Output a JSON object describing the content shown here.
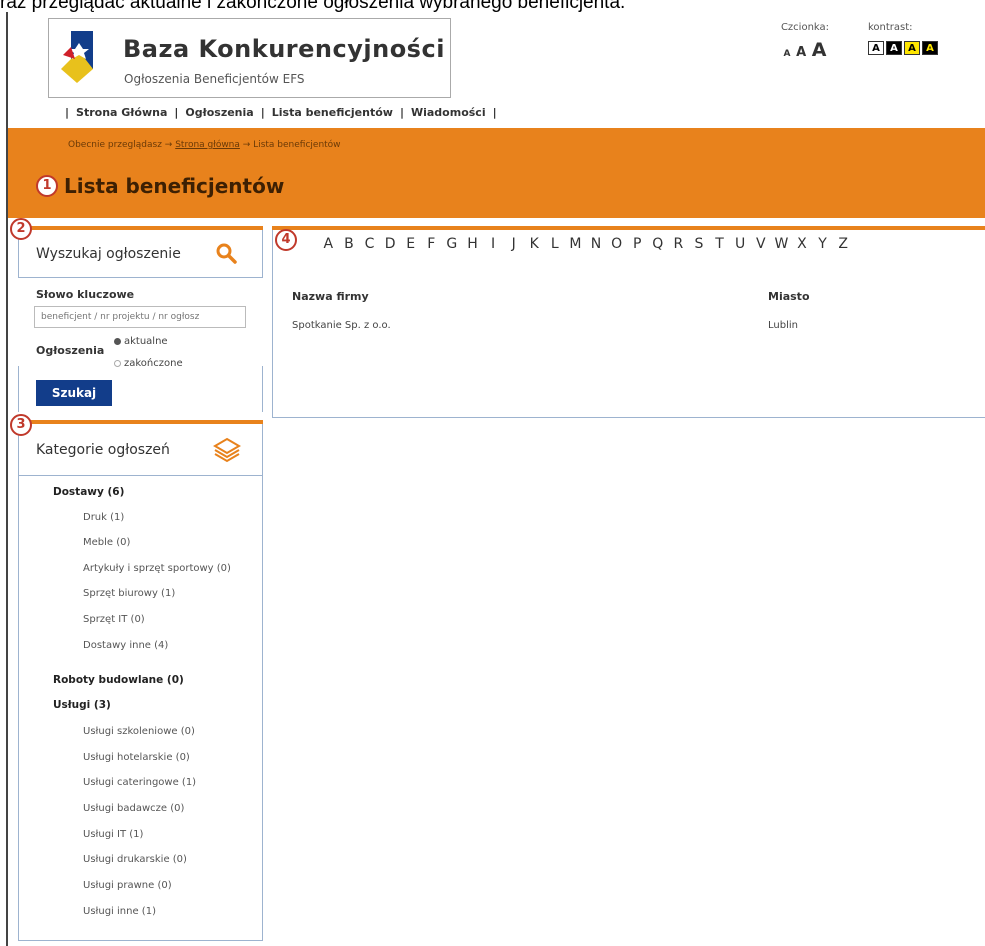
{
  "caption": "raz przeglądać aktualne i zakończone ogłoszenia wybranego beneficjenta.",
  "header": {
    "site_title": "Baza Konkurencyjności",
    "site_subtitle": "Ogłoszenia Beneficjentów EFS",
    "font_label": "Czcionka:",
    "font_sizes": [
      "A",
      "A",
      "A"
    ],
    "contrast_label": "kontrast:",
    "contrast_options": [
      "A",
      "A",
      "A",
      "A"
    ]
  },
  "nav": {
    "items": [
      "Strona Główna",
      "Ogłoszenia",
      "Lista beneficjentów",
      "Wiadomości"
    ]
  },
  "breadcrumb": {
    "prefix": "Obecnie przeglądasz →",
    "home": "Strona główna",
    "current": "→ Lista beneficjentów"
  },
  "page_title": "Lista beneficjentów",
  "badges": [
    "1",
    "2",
    "3",
    "4"
  ],
  "search": {
    "title": "Wyszukaj ogłoszenie",
    "keyword_label": "Słowo kluczowe",
    "keyword_placeholder": "beneficjent / nr projektu / nr ogłosz",
    "status_label": "Ogłoszenia",
    "options": [
      "aktualne",
      "zakończone"
    ],
    "selected": "aktualne",
    "button": "Szukaj"
  },
  "categories": {
    "title": "Kategorie ogłoszeń",
    "items": [
      {
        "label": "Dostawy (6)",
        "level": 0
      },
      {
        "label": "Druk (1)",
        "level": 1
      },
      {
        "label": "Meble (0)",
        "level": 1
      },
      {
        "label": "Artykuły i sprzęt sportowy (0)",
        "level": 1
      },
      {
        "label": "Sprzęt biurowy (1)",
        "level": 1
      },
      {
        "label": "Sprzęt IT (0)",
        "level": 1
      },
      {
        "label": "Dostawy inne (4)",
        "level": 1
      },
      {
        "label": "Roboty budowlane (0)",
        "level": 0
      },
      {
        "label": "Usługi (3)",
        "level": 0
      },
      {
        "label": "Usługi szkoleniowe (0)",
        "level": 1
      },
      {
        "label": "Usługi hotelarskie (0)",
        "level": 1
      },
      {
        "label": "Usługi cateringowe (1)",
        "level": 1
      },
      {
        "label": "Usługi badawcze (0)",
        "level": 1
      },
      {
        "label": "Usługi IT (1)",
        "level": 1
      },
      {
        "label": "Usługi drukarskie (0)",
        "level": 1
      },
      {
        "label": "Usługi prawne (0)",
        "level": 1
      },
      {
        "label": "Usługi inne (1)",
        "level": 1
      }
    ]
  },
  "alphabet": [
    "A",
    "B",
    "C",
    "D",
    "E",
    "F",
    "G",
    "H",
    "I",
    "J",
    "K",
    "L",
    "M",
    "N",
    "O",
    "P",
    "Q",
    "R",
    "S",
    "T",
    "U",
    "V",
    "W",
    "X",
    "Y",
    "Z"
  ],
  "table": {
    "headers": [
      "Nazwa firmy",
      "Miasto"
    ],
    "rows": [
      [
        "Spotkanie Sp. z o.o.",
        "Lublin"
      ]
    ]
  },
  "colors": {
    "accent": "#e8821c",
    "button": "#123d8a",
    "badge": "#c0392b"
  }
}
